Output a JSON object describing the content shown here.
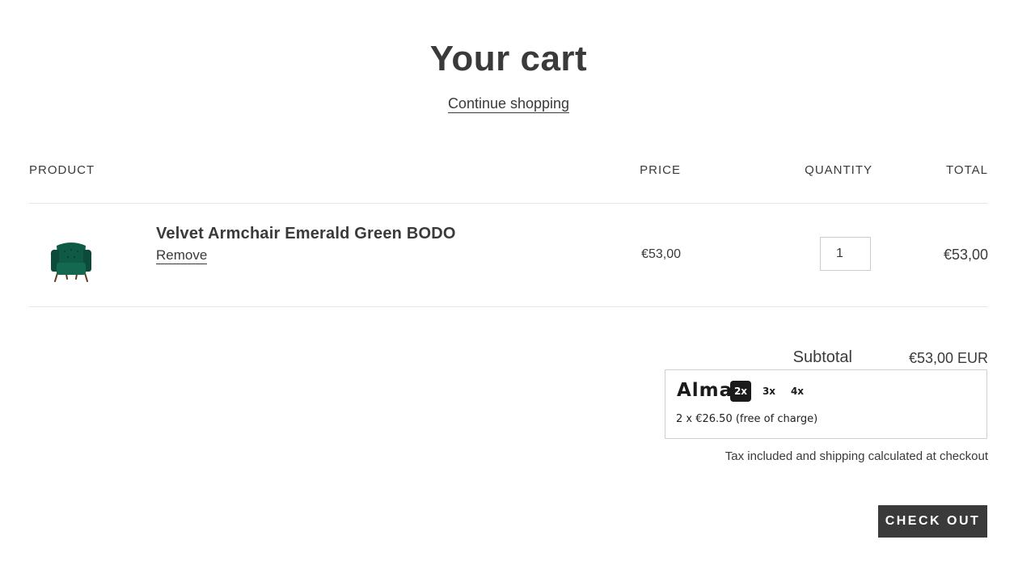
{
  "header": {
    "title": "Your cart",
    "continue_label": "Continue shopping"
  },
  "table": {
    "columns": [
      "PRODUCT",
      "PRICE",
      "QUANTITY",
      "TOTAL"
    ]
  },
  "items": [
    {
      "name": "Velvet Armchair Emerald Green BODO",
      "remove_label": "Remove",
      "price": "€53,00",
      "quantity": "1",
      "total": "€53,00",
      "thumbnail_icon": "armchair-icon",
      "thumbnail_color": "#0f5a45"
    }
  ],
  "summary": {
    "subtotal_label": "Subtotal",
    "subtotal_value": "€53,00 EUR",
    "tax_note": "Tax included and shipping calculated at checkout",
    "checkout_label": "CHECK OUT"
  },
  "alma": {
    "logo_text": "Alma",
    "options": [
      "2x",
      "3x",
      "4x"
    ],
    "selected": "2x",
    "plan_text": "2 x €26.50 (free of charge)"
  },
  "colors": {
    "text": "#3a3a3a",
    "button_bg": "#3a3a3a",
    "divider": "#e6e6e6",
    "alma_dark": "#1a1a1a"
  }
}
